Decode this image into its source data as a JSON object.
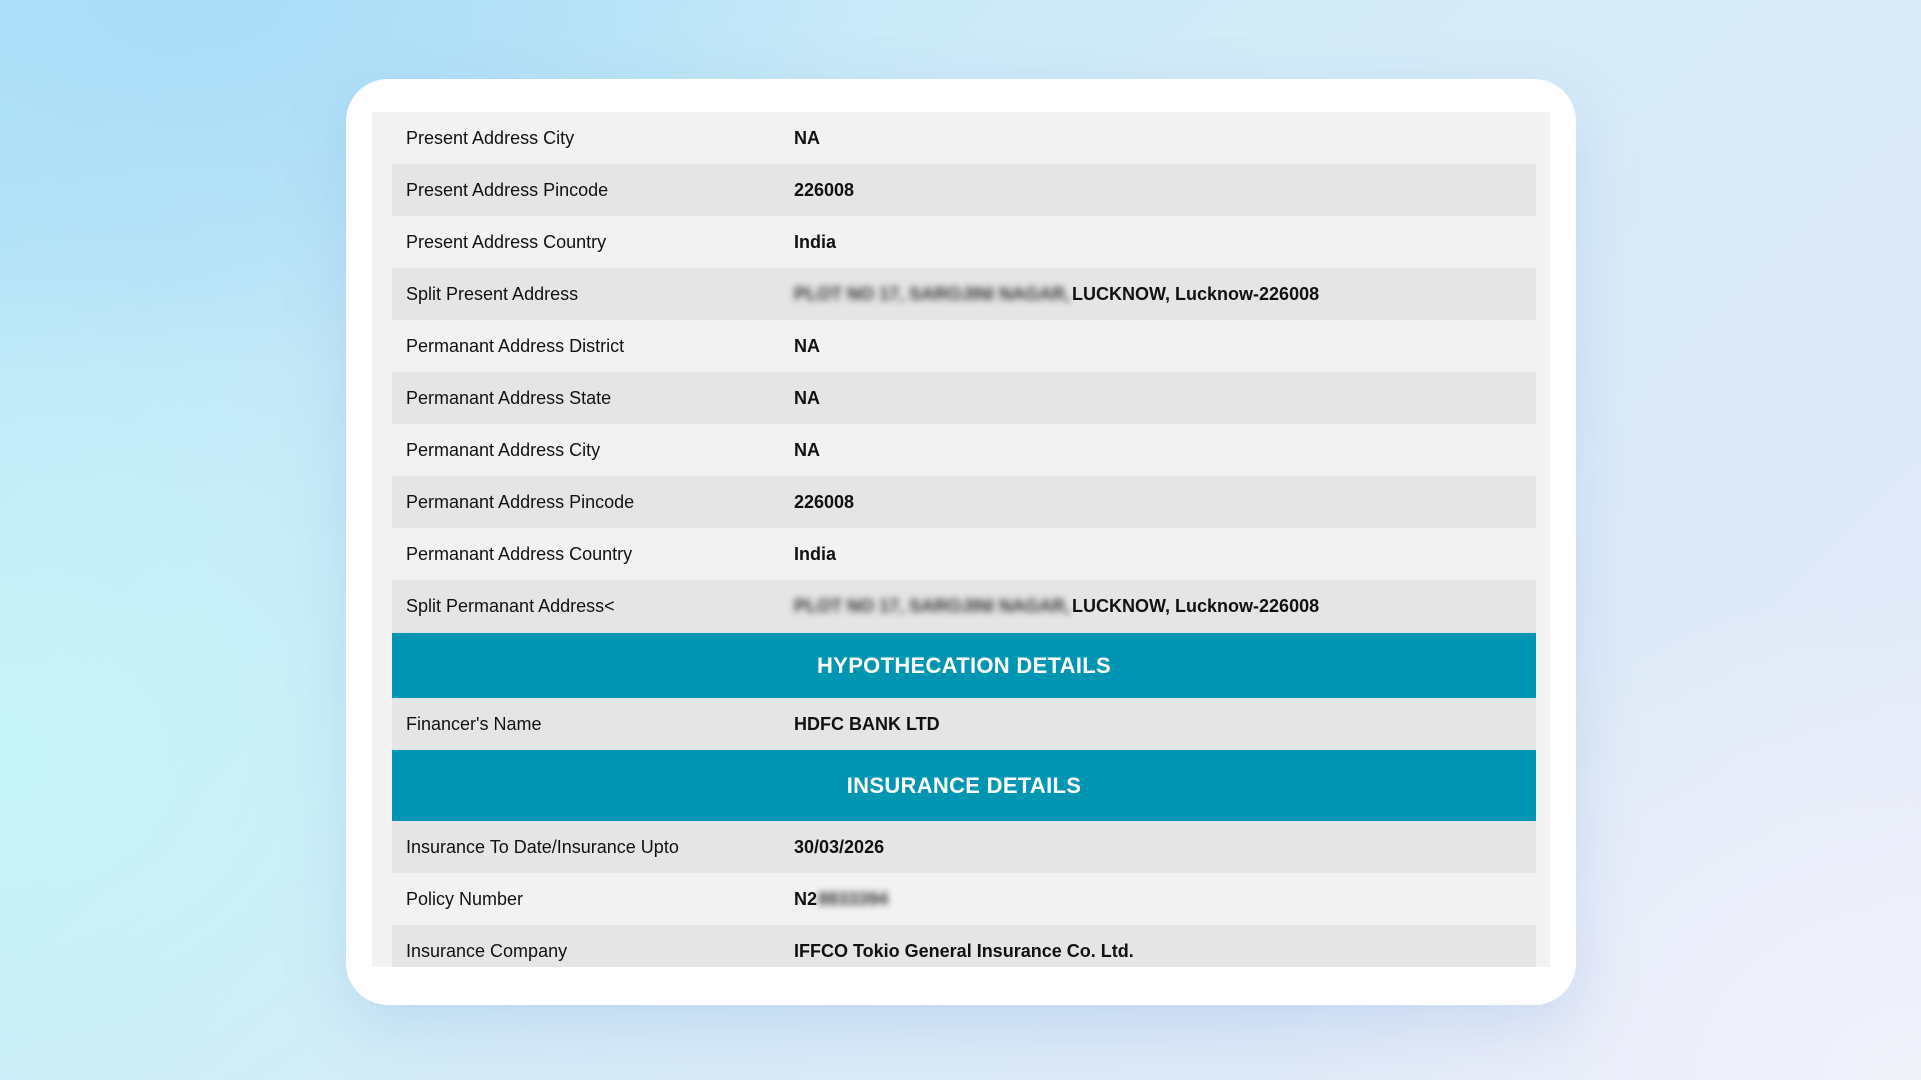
{
  "rows_top": [
    {
      "label": "Present Address City",
      "value": "NA"
    },
    {
      "label": "Present Address Pincode",
      "value": "226008"
    },
    {
      "label": "Present Address Country",
      "value": "India"
    },
    {
      "label": "Split Present Address",
      "value_blurred": "PLOT NO 17, SAROJINI NAGAR,",
      "value": "LUCKNOW, Lucknow-226008"
    },
    {
      "label": "Permanant Address District",
      "value": "NA"
    },
    {
      "label": "Permanant Address State",
      "value": "NA"
    },
    {
      "label": "Permanant Address City",
      "value": "NA"
    },
    {
      "label": "Permanant Address Pincode",
      "value": "226008"
    },
    {
      "label": "Permanant Address Country",
      "value": "India"
    },
    {
      "label": "Split Permanant Address<",
      "value_blurred": "PLOT NO 17, SAROJINI NAGAR,",
      "value": "LUCKNOW, Lucknow-226008"
    }
  ],
  "hypothecation": {
    "title": "HYPOTHECATION DETAILS",
    "rows": [
      {
        "label": "Financer's Name",
        "value": "HDFC BANK LTD"
      }
    ]
  },
  "insurance": {
    "title": "INSURANCE DETAILS",
    "rows": [
      {
        "label": "Insurance To Date/Insurance Upto",
        "value": "30/03/2026"
      },
      {
        "label": "Policy Number",
        "value": "N2",
        "value_blurred": "8833394"
      },
      {
        "label": "Insurance Company",
        "value": "IFFCO Tokio General Insurance Co. Ltd."
      }
    ]
  },
  "colors": {
    "section_header": "#0096b3",
    "row_light": "#f2f2f2",
    "row_dark": "#e5e5e5"
  }
}
